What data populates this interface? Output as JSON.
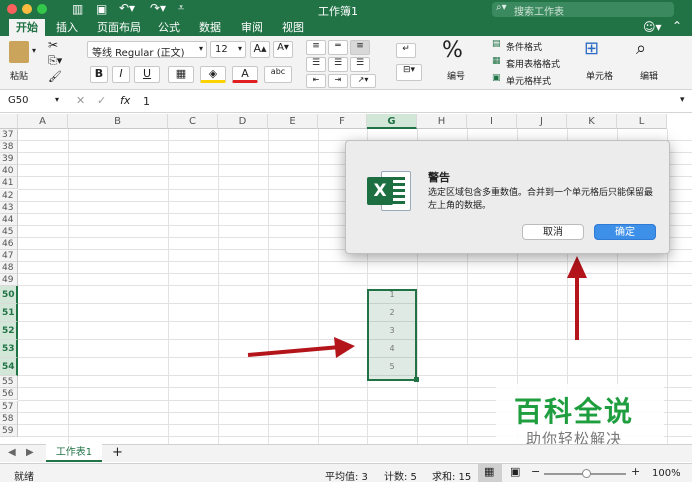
{
  "window": {
    "title": "工作簿1",
    "search_placeholder": "搜索工作表"
  },
  "tabs": [
    "开始",
    "插入",
    "页面布局",
    "公式",
    "数据",
    "审阅",
    "视图"
  ],
  "ribbon": {
    "paste": "粘贴",
    "font_name": "等线 Regular (正文)",
    "font_size": "12",
    "bold": "B",
    "italic": "I",
    "underline": "U",
    "fontcolor": "A",
    "phonetic": "abc",
    "percent": "%",
    "number": "编号",
    "cond_format": "条件格式",
    "table_format": "套用表格格式",
    "cell_style": "单元格样式",
    "cells": "单元格",
    "edit": "编辑"
  },
  "formula_bar": {
    "cell_ref": "G50",
    "fx": "fx",
    "value": "1",
    "cancel": "✕",
    "confirm": "✓"
  },
  "columns": [
    "A",
    "B",
    "C",
    "D",
    "E",
    "F",
    "G",
    "H",
    "I",
    "J",
    "K",
    "L"
  ],
  "rows": [
    "37",
    "38",
    "39",
    "40",
    "41",
    "42",
    "43",
    "44",
    "45",
    "46",
    "47",
    "48",
    "49",
    "50",
    "51",
    "52",
    "53",
    "54",
    "55",
    "56",
    "57",
    "58",
    "59"
  ],
  "selected_column": "G",
  "selected_rows": [
    "50",
    "51",
    "52",
    "53",
    "54"
  ],
  "selection_values": [
    "1",
    "2",
    "3",
    "4",
    "5"
  ],
  "dialog": {
    "title": "警告",
    "message": "选定区域包含多重数值。合并到一个单元格后只能保留最左上角的数据。",
    "cancel": "取消",
    "ok": "确定"
  },
  "sheet_tabs": {
    "name": "工作表1",
    "add": "+"
  },
  "status": {
    "ready": "就绪",
    "average": "平均值: 3",
    "count": "计数: 5",
    "sum": "求和: 15",
    "zoom": "100%",
    "minus": "−",
    "plus": "+"
  },
  "watermark": {
    "line1": "百科全说",
    "line2": "助你轻松解决"
  },
  "colors": {
    "accent": "#217346",
    "arrow": "#b3151b",
    "ok_button": "#3d8fe8"
  }
}
